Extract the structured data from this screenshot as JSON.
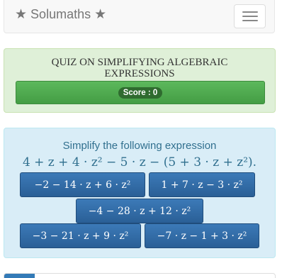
{
  "navbar": {
    "brand": "Solumaths",
    "brand_star_icon": "star-icon",
    "menu_icon": "hamburger-icon"
  },
  "quiz": {
    "title": "QUIZ ON SIMPLIFYING ALGEBRAIC EXPRESSIONS",
    "score_label": "Score : 0"
  },
  "exercise": {
    "instruction": "Simplify the following expression",
    "expression": "4 + z + 4 · z² − 5 · z − (5 + 3 · z + z²)."
  },
  "answers": [
    "−2 − 14 · z + 6 · z²",
    "1 + 7 · z − 3 · z²",
    "−4 − 28 · z + 12 · z²",
    "−3 − 21 · z + 9 · z²",
    "−7 · z − 1 + 3 · z²"
  ],
  "colors": {
    "success_bg": "#dff0d8",
    "score_bar": "#5cb85c",
    "info_bg": "#d9edf7",
    "info_text": "#31708f",
    "answer_button": "#2a5f96"
  }
}
